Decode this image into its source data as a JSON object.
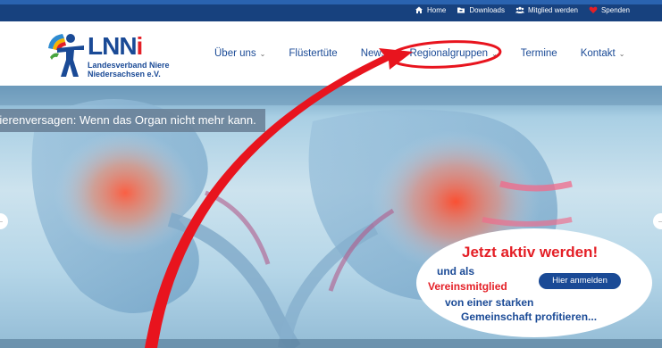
{
  "topbar": {
    "links": [
      {
        "label": "Home",
        "icon": "home-icon"
      },
      {
        "label": "Downloads",
        "icon": "folder-icon"
      },
      {
        "label": "Mitglied werden",
        "icon": "users-icon"
      },
      {
        "label": "Spenden",
        "icon": "heart-icon"
      }
    ]
  },
  "logo": {
    "word_main": "LNN",
    "word_end": "i",
    "subtitle_line1": "Landesverband Niere",
    "subtitle_line2": "Niedersachsen e.V."
  },
  "nav": {
    "items": [
      {
        "label": "Über uns",
        "has_dropdown": true
      },
      {
        "label": "Flüstertüte",
        "has_dropdown": false
      },
      {
        "label": "News",
        "has_dropdown": false
      },
      {
        "label": "Regionalgruppen",
        "has_dropdown": true
      },
      {
        "label": "Termine",
        "has_dropdown": false
      },
      {
        "label": "Kontakt",
        "has_dropdown": true
      }
    ]
  },
  "hero": {
    "caption": "Nierenversagen: Wenn das Organ nicht mehr kann.",
    "prev_arrow": "←",
    "next_arrow": "→",
    "cta": {
      "title": "Jetzt aktiv werden!",
      "line1": "und als",
      "line2": "Vereinsmitglied",
      "line3": "von einer starken",
      "line4": "Gemeinschaft profitieren...",
      "button": "Hier anmelden"
    }
  },
  "colors": {
    "brand_blue": "#1a4a96",
    "brand_red": "#e41f26",
    "topbar": "#17417e",
    "annotation": "#e8141e"
  }
}
